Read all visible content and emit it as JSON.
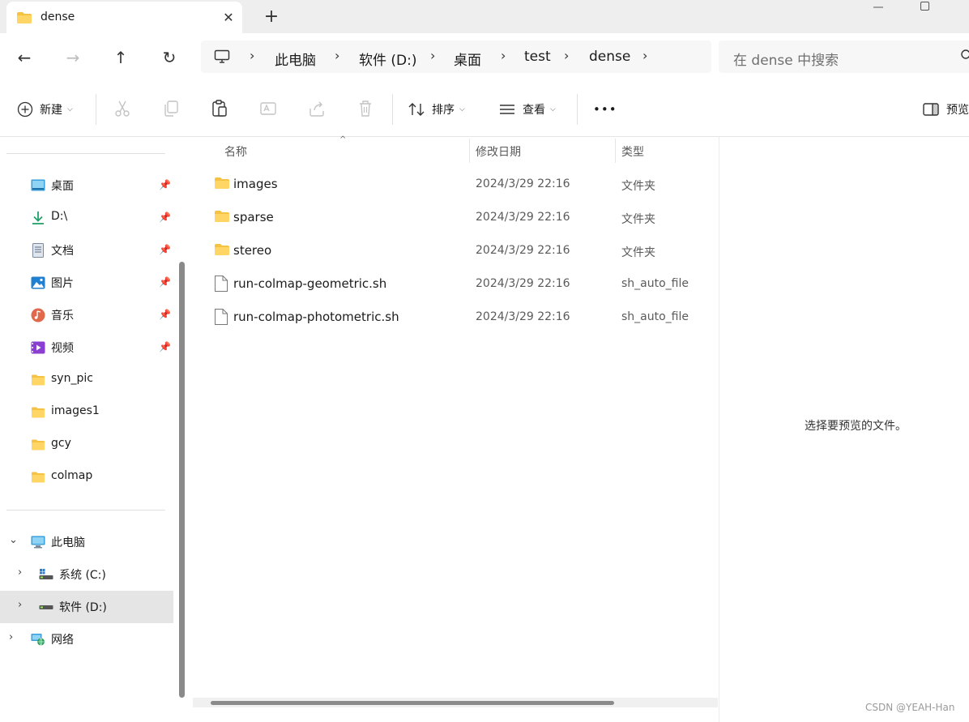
{
  "tab": {
    "title": "dense",
    "close_glyph": "✕",
    "newtab_glyph": "+"
  },
  "nav": {
    "back": "←",
    "forward": "→",
    "up": "↑",
    "refresh": "↻"
  },
  "address": {
    "crumbs": [
      "此电脑",
      "软件 (D:)",
      "桌面",
      "test",
      "dense"
    ],
    "separator": "›"
  },
  "search": {
    "placeholder": "在 dense 中搜索"
  },
  "toolbar": {
    "new_label": "新建",
    "sort_label": "排序",
    "view_label": "查看",
    "more_label": "•••",
    "preview_label": "预览"
  },
  "sidebar": {
    "quick_access": [
      {
        "label": "桌面",
        "icon": "desktop-icon",
        "pinned": true
      },
      {
        "label": "D:\\",
        "icon": "download-icon",
        "pinned": true
      },
      {
        "label": "文档",
        "icon": "document-icon",
        "pinned": true
      },
      {
        "label": "图片",
        "icon": "pictures-icon",
        "pinned": true
      },
      {
        "label": "音乐",
        "icon": "music-icon",
        "pinned": true
      },
      {
        "label": "视频",
        "icon": "video-icon",
        "pinned": true
      },
      {
        "label": "syn_pic",
        "icon": "folder-icon",
        "pinned": false
      },
      {
        "label": "images1",
        "icon": "folder-icon",
        "pinned": false
      },
      {
        "label": "gcy",
        "icon": "folder-icon",
        "pinned": false
      },
      {
        "label": "colmap",
        "icon": "folder-icon",
        "pinned": false
      }
    ],
    "this_pc": "此电脑",
    "drives": [
      {
        "label": "系统 (C:)",
        "selected": false
      },
      {
        "label": "软件 (D:)",
        "selected": true
      }
    ],
    "network": "网络"
  },
  "columns": {
    "name": "名称",
    "date": "修改日期",
    "type": "类型"
  },
  "files": [
    {
      "name": "images",
      "date": "2024/3/29 22:16",
      "type": "文件夹",
      "kind": "folder"
    },
    {
      "name": "sparse",
      "date": "2024/3/29 22:16",
      "type": "文件夹",
      "kind": "folder"
    },
    {
      "name": "stereo",
      "date": "2024/3/29 22:16",
      "type": "文件夹",
      "kind": "folder"
    },
    {
      "name": "run-colmap-geometric.sh",
      "date": "2024/3/29 22:16",
      "type": "sh_auto_file",
      "kind": "file"
    },
    {
      "name": "run-colmap-photometric.sh",
      "date": "2024/3/29 22:16",
      "type": "sh_auto_file",
      "kind": "file"
    }
  ],
  "preview": {
    "message": "选择要预览的文件。"
  },
  "watermark": "CSDN @YEAH-Han",
  "colors": {
    "folder": "#f5c242",
    "selected": "#e5e5e5",
    "chrome": "#eeeeee"
  }
}
